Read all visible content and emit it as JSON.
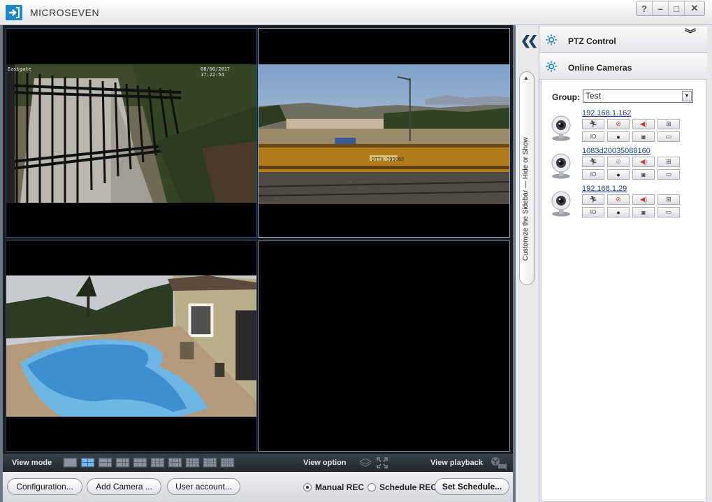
{
  "app": {
    "title": "MICROSEVEN",
    "window_buttons": [
      "?",
      "–",
      "□",
      "✕"
    ]
  },
  "video": {
    "cells": [
      {
        "osd_left": "Eastgate",
        "osd_right": "08/06/2017 17:22:54"
      },
      {
        "osd_train": "DTTX 795065"
      },
      {},
      {}
    ]
  },
  "viewbar": {
    "view_mode_label": "View mode",
    "view_option_label": "View option",
    "view_playback_label": "View playback",
    "layouts": [
      "single",
      "quad",
      "six",
      "eight",
      "nine",
      "ten",
      "thirteen",
      "sixteen",
      "twenty",
      "twentyfive"
    ],
    "active_layout": "quad"
  },
  "bottombar": {
    "configuration_label": "Configuration...",
    "add_camera_label": "Add Camera ...",
    "user_account_label": "User account...",
    "manual_rec_label": "Manual REC",
    "schedule_rec_label": "Schedule REC",
    "set_schedule_label": "Set Schedule...",
    "selected_rec_mode": "Manual REC"
  },
  "strip": {
    "collapse_icon": "double-chevron-left-icon",
    "sidebar_toggle_text": "Customize the Sidebar — Hide or Show"
  },
  "sidebar": {
    "ptz_title": "PTZ Control",
    "online_title": "Online Cameras",
    "group_label": "Group:",
    "group_value": "Test",
    "cameras": [
      {
        "name": "192.168.1.162"
      },
      {
        "name": "1083d20035088160"
      },
      {
        "name": "192.168.1.29"
      }
    ],
    "control_icons": [
      "motion-alarm-icon",
      "mute-icon",
      "speaker-icon",
      "network-icon",
      "io-alarm-icon",
      "record-icon",
      "snapshot-icon",
      "stream-icon"
    ]
  },
  "colors": {
    "accent": "#1c87c9",
    "link": "#1a3c8c",
    "video_bg": "#000000"
  }
}
